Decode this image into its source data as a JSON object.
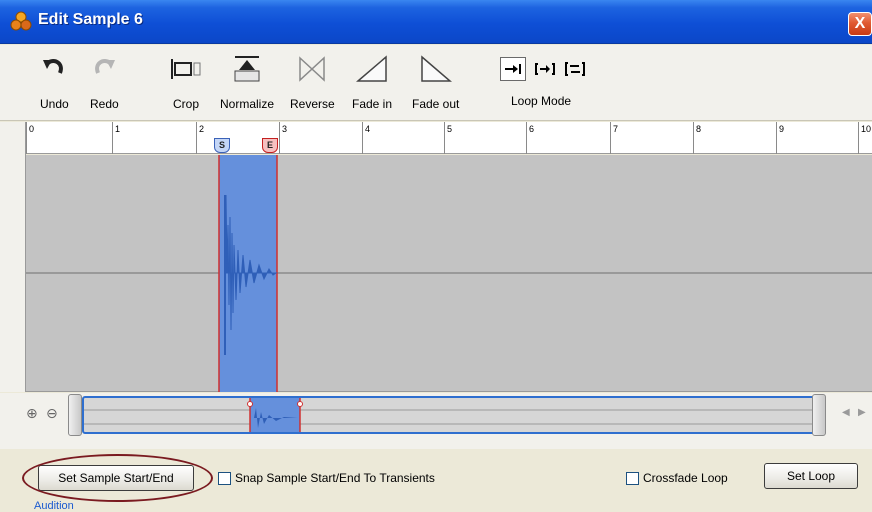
{
  "window": {
    "title": "Edit Sample 6",
    "close_glyph": "X"
  },
  "toolbar": {
    "undo": "Undo",
    "redo": "Redo",
    "crop": "Crop",
    "normalize": "Normalize",
    "reverse": "Reverse",
    "fade_in": "Fade in",
    "fade_out": "Fade out",
    "loop_mode": "Loop Mode"
  },
  "ruler": {
    "ticks": [
      "0",
      "1",
      "2",
      "3",
      "4",
      "5",
      "6",
      "7",
      "8",
      "9",
      "10"
    ],
    "start_marker": "S",
    "end_marker": "E"
  },
  "footer": {
    "set_sample_button": "Set Sample Start/End",
    "snap_checkbox": "Snap Sample Start/End To Transients",
    "crossfade_checkbox": "Crossfade Loop",
    "set_loop_button": "Set Loop",
    "audition": "Audition"
  },
  "colors": {
    "selection": "#6590dc",
    "waveform": "#2f5fb8",
    "marker_line": "#d03030",
    "title_bar": "#0e4fd6"
  },
  "icons": {
    "app": "app-logo-icon",
    "zoom_in": "zoom-in-icon",
    "zoom_out": "zoom-out-icon"
  }
}
